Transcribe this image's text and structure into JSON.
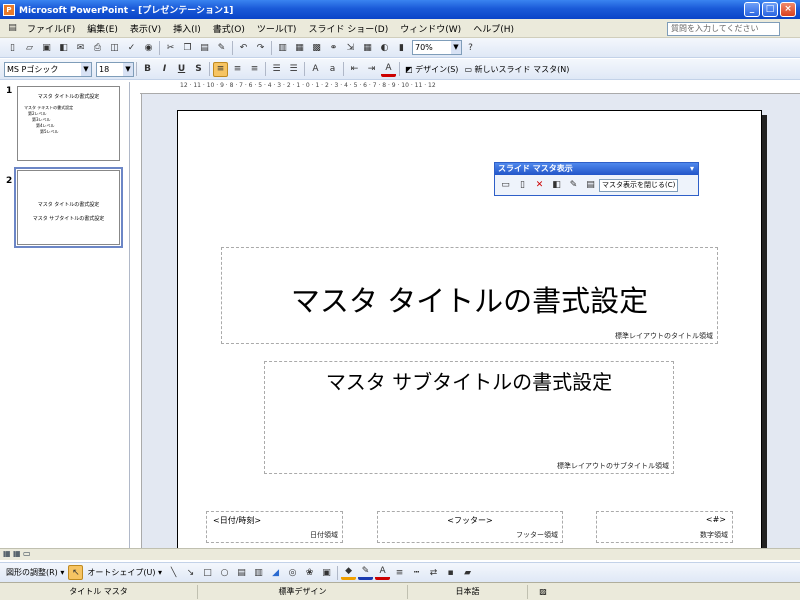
{
  "window": {
    "title": "Microsoft PowerPoint - [プレゼンテーション1]"
  },
  "menu": [
    "ファイル(F)",
    "編集(E)",
    "表示(V)",
    "挿入(I)",
    "書式(O)",
    "ツール(T)",
    "スライド ショー(D)",
    "ウィンドウ(W)",
    "ヘルプ(H)"
  ],
  "help_placeholder": "質問を入力してください",
  "toolbar": {
    "zoom": "70%",
    "font": "MS Pゴシック",
    "font_size": "18",
    "bold": "B",
    "italic": "I",
    "underline": "U",
    "shadow": "S",
    "design": "デザイン(S)",
    "new_master": "新しいスライド マスタ(N)"
  },
  "thumbnails": [
    {
      "num": "1",
      "title": "マスタ タイトルの書式設定",
      "lines": [
        "マスタ テキストの書式設定",
        "第2レベル",
        "第3レベル",
        "第4レベル",
        "第5レベル"
      ]
    },
    {
      "num": "2",
      "title": "マスタ タイトルの書式設定",
      "lines": [
        "マスタ サブタイトルの書式設定"
      ]
    }
  ],
  "ruler_text": "12 · 11 · 10 · 9 · 8 · 7 · 6 · 5 · 4 · 3 · 2 · 1 · 0 · 1 · 2 · 3 · 4 · 5 · 6 · 7 · 8 · 9 · 10 · 11 · 12",
  "slide": {
    "title": "マスタ タイトルの書式設定",
    "title_area_label": "標準レイアウトのタイトル領域",
    "subtitle": "マスタ サブタイトルの書式設定",
    "subtitle_area_label": "標準レイアウトのサブタイトル領域",
    "date_text": "<日付/時刻>",
    "date_label": "日付領域",
    "footer_text": "<フッター>",
    "footer_label": "フッター領域",
    "number_text": "<#>",
    "number_label": "数字領域"
  },
  "float_toolbar": {
    "title": "スライド マスタ表示",
    "close_label": "マスタ表示を閉じる(C)"
  },
  "draw_toolbar": {
    "draw": "図形の調整(R)",
    "autoshape": "オートシェイプ(U)"
  },
  "status": {
    "left": "タイトル マスタ",
    "design": "標準デザイン",
    "lang": "日本語"
  },
  "colors": {
    "titlebar": "#0a44c8",
    "selection": "#6c86c6"
  }
}
